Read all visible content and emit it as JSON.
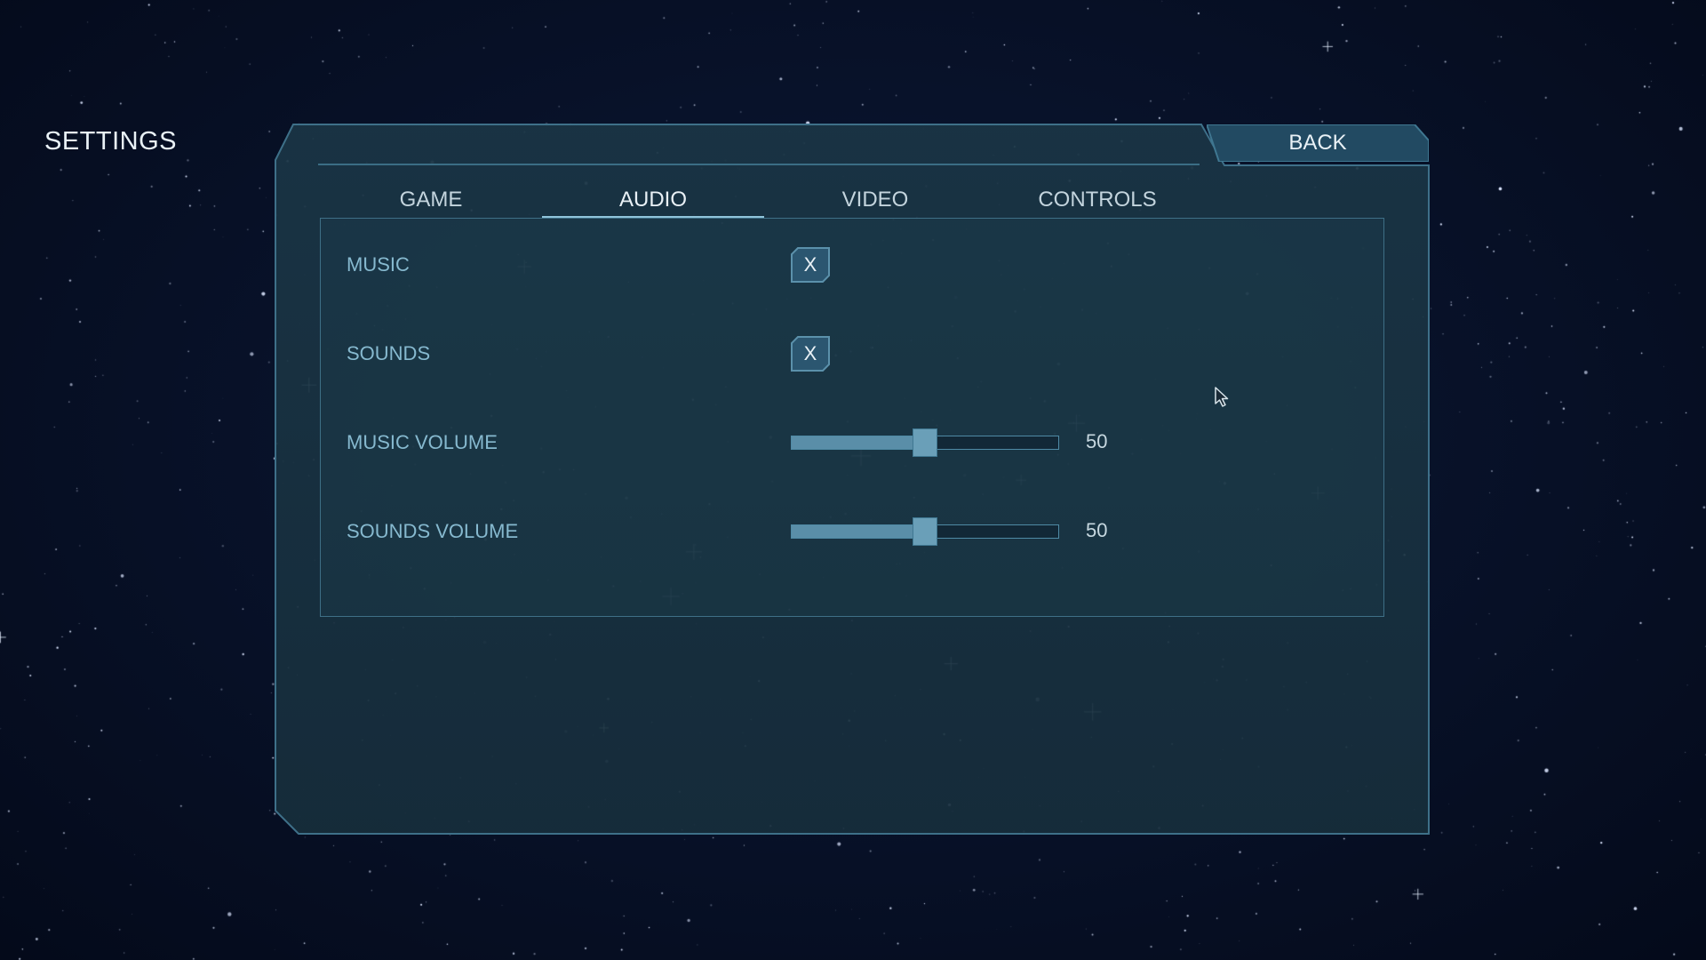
{
  "screen": {
    "title": "SETTINGS",
    "back_label": "BACK"
  },
  "tabs": [
    {
      "label": "GAME",
      "active": false
    },
    {
      "label": "AUDIO",
      "active": true
    },
    {
      "label": "VIDEO",
      "active": false
    },
    {
      "label": "CONTROLS",
      "active": false
    }
  ],
  "audio": {
    "music": {
      "label": "MUSIC",
      "checked": true,
      "mark": "X"
    },
    "sounds": {
      "label": "SOUNDS",
      "checked": true,
      "mark": "X"
    },
    "music_volume": {
      "label": "MUSIC VOLUME",
      "value": 50,
      "min": 0,
      "max": 100,
      "display": "50"
    },
    "sounds_volume": {
      "label": "SOUNDS VOLUME",
      "value": 50,
      "min": 0,
      "max": 100,
      "display": "50"
    }
  },
  "theme": {
    "panel_bg": "#1a3443",
    "accent": "#8fc4da",
    "frame": "#3b6d85",
    "text": "#e9f1f6",
    "label": "#86b9cf"
  },
  "icons": {
    "cursor": "arrow-cursor-icon",
    "checkbox": "x-mark-icon"
  }
}
